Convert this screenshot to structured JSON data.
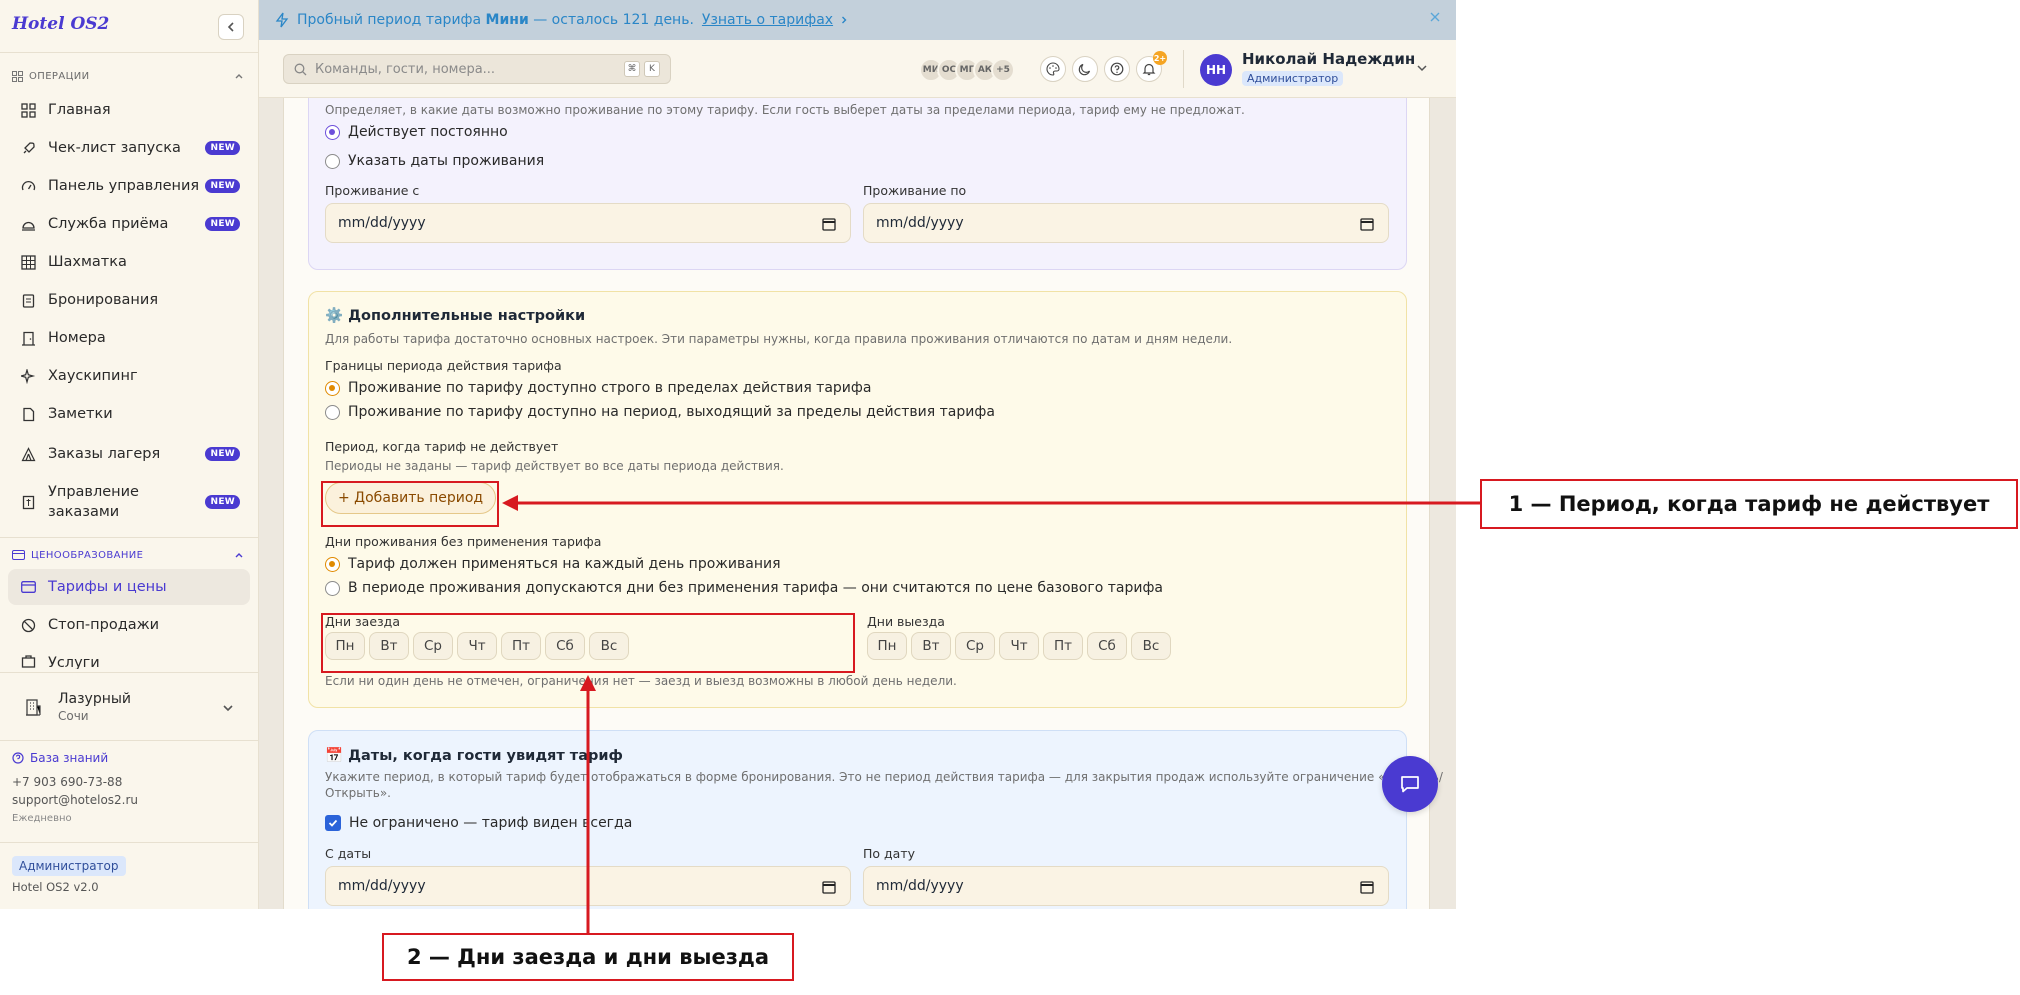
{
  "app": {
    "brand": "Hotel OS2",
    "version": "Hotel OS2 v2.0"
  },
  "colors": {
    "accent": "#4a3ad1",
    "annotation_red": "#d71920",
    "trial_bar": "#c3d0db",
    "radio_orange": "#e08a00",
    "radio_purple": "#6d4fdb"
  },
  "sidebar": {
    "section_operations": "ОПЕРАЦИИ",
    "section_pricing": "ЦЕНООБРАЗОВАНИЕ",
    "items": [
      {
        "label": "Главная",
        "icon": "grid-icon",
        "new": false
      },
      {
        "label": "Чек-лист запуска",
        "icon": "rocket-icon",
        "new": true
      },
      {
        "label": "Панель управления",
        "icon": "gauge-icon",
        "new": true
      },
      {
        "label": "Служба приёма",
        "icon": "bell-desk-icon",
        "new": true
      },
      {
        "label": "Шахматка",
        "icon": "table-grid-icon",
        "new": false
      },
      {
        "label": "Бронирования",
        "icon": "clipboard-icon",
        "new": false
      },
      {
        "label": "Номера",
        "icon": "door-icon",
        "new": false
      },
      {
        "label": "Хаускипинг",
        "icon": "sparkles-icon",
        "new": false
      },
      {
        "label": "Заметки",
        "icon": "note-icon",
        "new": false
      },
      {
        "label": "Заказы лагеря",
        "icon": "tent-icon",
        "new": true
      },
      {
        "label": "Управление заказами",
        "icon": "receipt-icon",
        "new": true
      }
    ],
    "pricing_items": [
      {
        "label": "Тарифы и цены",
        "icon": "credit-card-icon",
        "active": true
      },
      {
        "label": "Стоп-продажи",
        "icon": "ban-icon",
        "active": false
      },
      {
        "label": "Услуги",
        "icon": "services-icon",
        "active": false
      }
    ],
    "new_badge": "NEW",
    "hotel": {
      "name": "Лазурный",
      "city": "Сочи"
    },
    "knowledge_base": "База знаний",
    "phone": "+7 903 690-73-88",
    "email": "support@hotelos2.ru",
    "schedule": "Ежедневно",
    "role": "Администратор"
  },
  "trial": {
    "text_before": "Пробный период тарифа ",
    "plan": "Мини",
    "text_after": " — осталось 121 день.",
    "link": "Узнать о тарифах"
  },
  "topbar": {
    "search_placeholder": "Команды, гости, номера...",
    "shortcut_1": "⌘",
    "shortcut_2": "K",
    "avatars": [
      "МИ",
      "ОС",
      "МГ",
      "АК",
      "+5"
    ],
    "notifications": "2+",
    "user_initials": "НН",
    "user_name": "Николай Надеждин",
    "user_role": "Администратор"
  },
  "period_card": {
    "desc": "Определяет, в какие даты возможно проживание по этому тарифу. Если гость выберет даты за пределами периода, тариф ему не предложат.",
    "opt_always": "Действует постоянно",
    "opt_dates": "Указать даты проживания",
    "from_label": "Проживание с",
    "to_label": "Проживание по",
    "date_placeholder": "mm/dd/yyyy"
  },
  "extra_card": {
    "title": "⚙️ Дополнительные настройки",
    "desc": "Для работы тарифа достаточно основных настроек. Эти параметры нужны, когда правила проживания отличаются по датам и дням недели.",
    "bounds_label": "Границы периода действия тарифа",
    "bounds_opt1": "Проживание по тарифу доступно строго в пределах действия тарифа",
    "bounds_opt2": "Проживание по тарифу доступно на период, выходящий за пределы действия тарифа",
    "inactive_label": "Период, когда тариф не действует",
    "inactive_hint": "Периоды не заданы — тариф действует во все даты периода действия.",
    "add_period": "+ Добавить период",
    "days_label": "Дни проживания без применения тарифа",
    "days_opt1": "Тариф должен применяться на каждый день проживания",
    "days_opt2": "В периоде проживания допускаются дни без применения тарифа — они считаются по цене базового тарифа",
    "arrival_label": "Дни заезда",
    "departure_label": "Дни выезда",
    "weekdays": [
      "Пн",
      "Вт",
      "Ср",
      "Чт",
      "Пт",
      "Сб",
      "Вс"
    ],
    "days_hint": "Если ни один день не отмечен, ограничения нет — заезд и выезд возможны в любой день недели."
  },
  "visible_card": {
    "title": "📅 Даты, когда гости увидят тариф",
    "desc_line1": "Укажите период, в который тариф будет отображаться в форме бронирования. Это не период действия тарифа — для закрытия продаж используйте ограничение «Закрыть/",
    "desc_line2": "Открыть».",
    "unlimited": "Не ограничено — тариф виден всегда",
    "from_label": "С даты",
    "to_label": "По дату",
    "date_placeholder": "mm/dd/yyyy"
  },
  "annotations": {
    "label_1": "1 — Период, когда тариф не действует",
    "label_2": "2 — Дни заезда и дни выезда"
  }
}
